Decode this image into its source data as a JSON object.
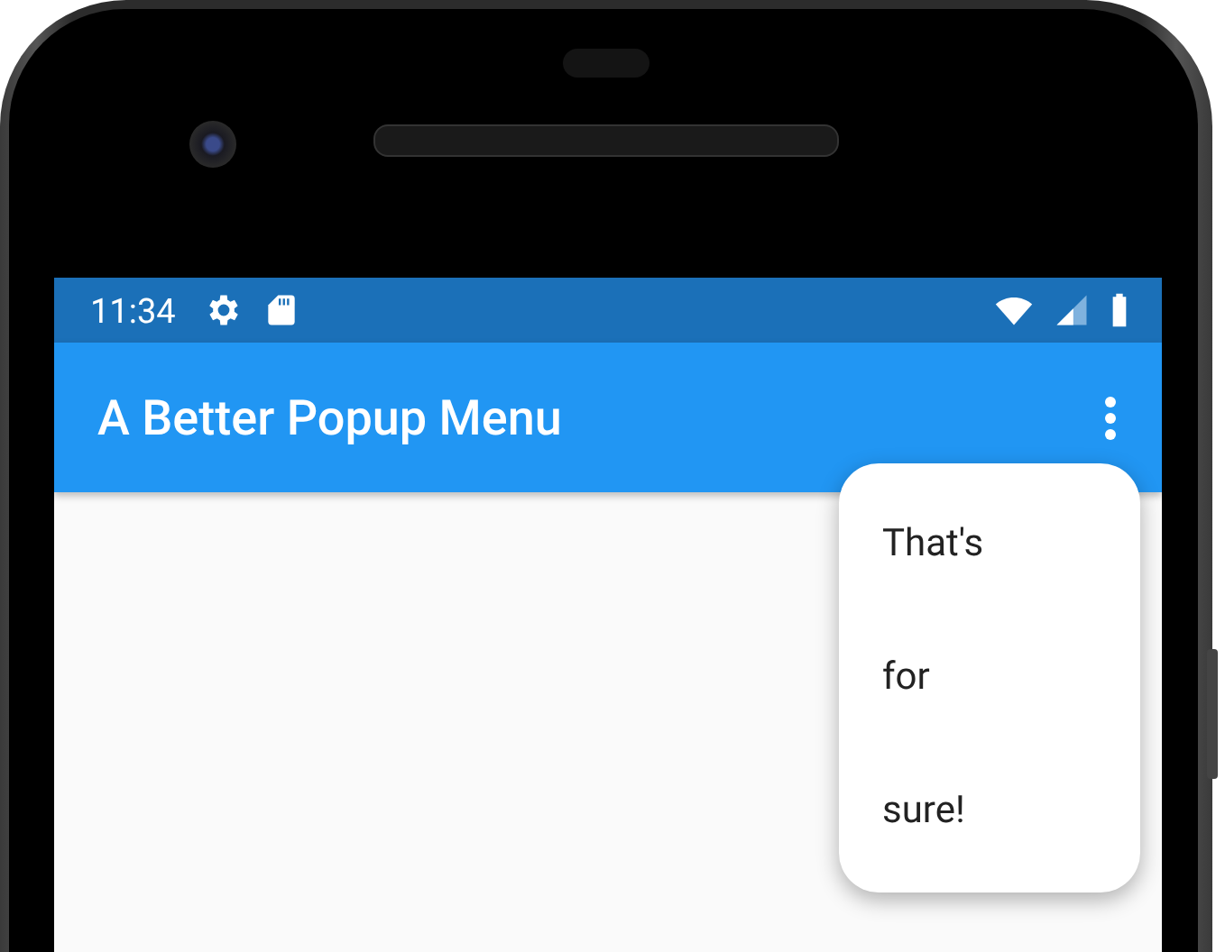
{
  "status_bar": {
    "time": "11:34"
  },
  "app_bar": {
    "title": "A Better Popup Menu"
  },
  "popup_menu": {
    "items": [
      {
        "label": "That's"
      },
      {
        "label": "for"
      },
      {
        "label": "sure!"
      }
    ]
  }
}
